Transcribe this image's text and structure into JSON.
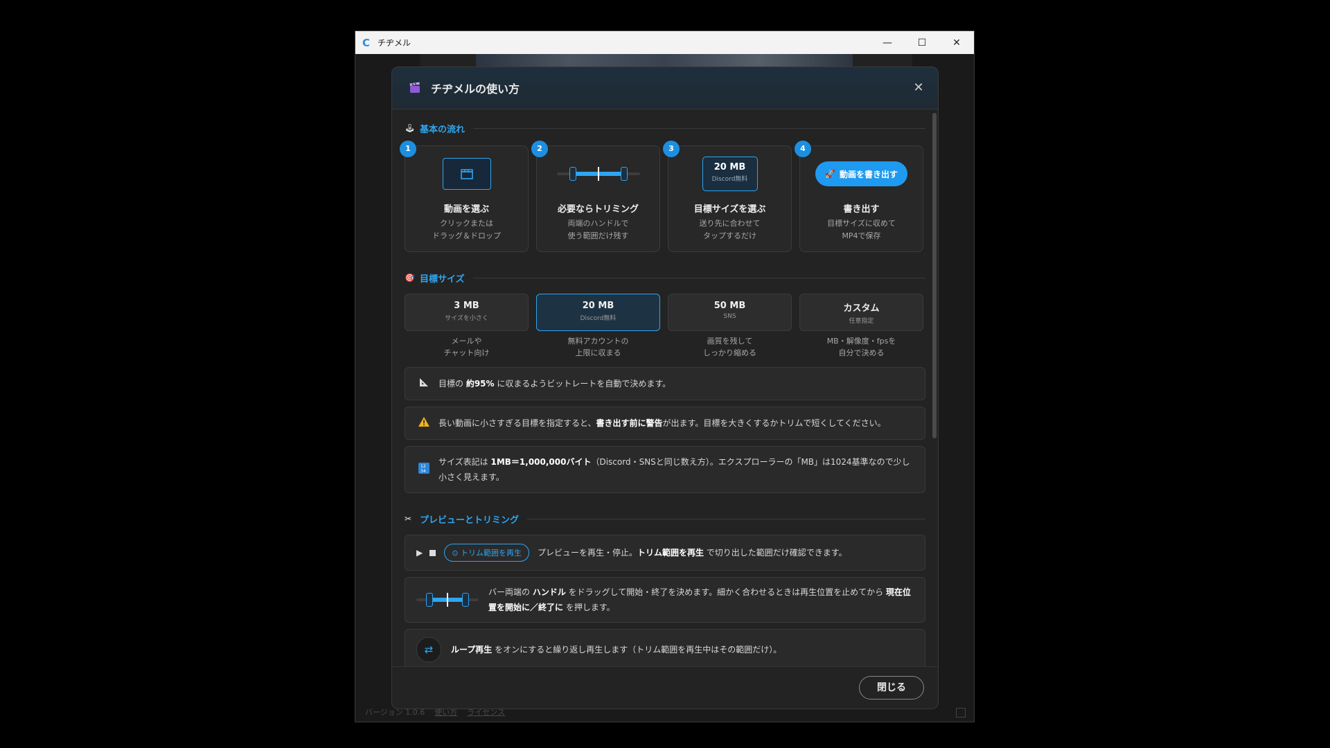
{
  "window": {
    "title": "チヂメル",
    "minimize": "—",
    "maximize": "☐",
    "close": "✕"
  },
  "footer": {
    "version": "バージョン 1.0.6",
    "howto": "使い方",
    "license": "ライセンス"
  },
  "dialog": {
    "title": "チヂメルの使い方",
    "close_label": "閉じる",
    "sections": {
      "flow": "基本の流れ",
      "target": "目標サイズ",
      "preview": "プレビューとトリミング"
    },
    "steps": [
      {
        "num": "1",
        "title": "動画を選ぶ",
        "desc1": "クリックまたは",
        "desc2": "ドラッグ＆ドロップ"
      },
      {
        "num": "2",
        "title": "必要ならトリミング",
        "desc1": "両端のハンドルで",
        "desc2": "使う範囲だけ残す"
      },
      {
        "num": "3",
        "title": "目標サイズを選ぶ",
        "desc1": "送り先に合わせて",
        "desc2": "タップするだけ",
        "chip_value": "20 MB",
        "chip_sub": "Discord無料"
      },
      {
        "num": "4",
        "title": "書き出す",
        "desc1": "目標サイズに収めて",
        "desc2": "MP4で保存",
        "button": "動画を書き出す"
      }
    ],
    "sizes": [
      {
        "value": "3 MB",
        "sub": "サイズを小さく",
        "note1": "メールや",
        "note2": "チャット向け",
        "selected": false
      },
      {
        "value": "20 MB",
        "sub": "Discord無料",
        "note1": "無料アカウントの",
        "note2": "上限に収まる",
        "selected": true
      },
      {
        "value": "50 MB",
        "sub": "SNS",
        "note1": "画質を残して",
        "note2": "しっかり縮める",
        "selected": false
      },
      {
        "value": "カスタム",
        "sub": "任意指定",
        "note1": "MB・解像度・fpsを",
        "note2": "自分で決める",
        "selected": false
      }
    ],
    "info": {
      "bitrate_pre": "目標の ",
      "bitrate_bold": "約95%",
      "bitrate_post": " に収まるようビットレートを自動で決めます。",
      "warn_pre": "長い動画に小さすぎる目標を指定すると、",
      "warn_bold": "書き出す前に警告",
      "warn_post": "が出ます。目標を大きくするかトリムで短くしてください。",
      "unit_pre": "サイズ表記は ",
      "unit_bold": "1MB＝1,000,000バイト",
      "unit_post": "（Discord・SNSと同じ数え方）。エクスプローラーの「MB」は1024基準なので少し小さく見えます。"
    },
    "preview": {
      "trim_play": "トリム範囲を再生",
      "play_pre": "プレビューを再生・停止。",
      "play_bold": "トリム範囲を再生",
      "play_post": " で切り出した範囲だけ確認できます。",
      "handle_pre": "バー両端の ",
      "handle_bold1": "ハンドル",
      "handle_mid": " をドラッグして開始・終了を決めます。細かく合わせるときは再生位置を止めてから ",
      "handle_bold2": "現在位置を開始に／終了に",
      "handle_post": " を押します。",
      "loop_bold": "ループ再生",
      "loop_post": " をオンにすると繰り返し再生します（トリム範囲を再生中はその範囲だけ）。"
    }
  },
  "colors": {
    "accent": "#2fa6f0",
    "badge": "#1d8fe0",
    "background": "#232323"
  },
  "icons": {
    "app": "c-logo-icon",
    "clapper": "clapperboard-icon",
    "joystick": "joystick-icon",
    "target": "target-icon",
    "scissors": "scissors-icon",
    "ruler": "ruler-icon",
    "warning": "warning-icon",
    "numbers": "numbers-icon",
    "rocket": "rocket-icon",
    "play": "play-icon",
    "stop": "stop-icon",
    "loop": "loop-icon"
  }
}
